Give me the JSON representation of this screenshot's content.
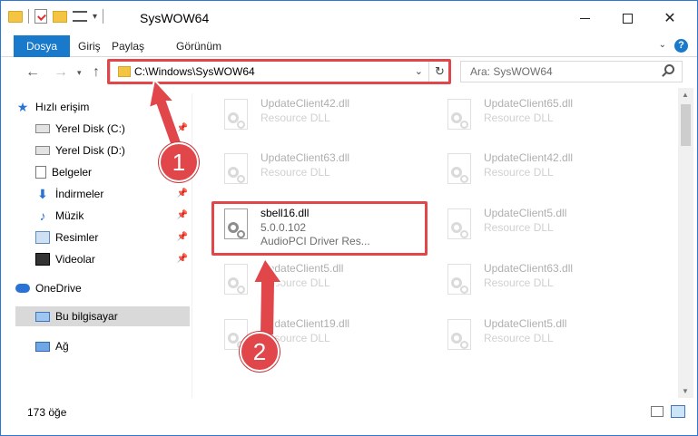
{
  "window": {
    "title": "SysWOW64",
    "close_symbol": "✕"
  },
  "ribbon": {
    "tabs": [
      "Dosya",
      "Giriş",
      "Paylaş",
      "Görünüm"
    ],
    "help": "?"
  },
  "address": {
    "path": "C:\\Windows\\SysWOW64"
  },
  "search": {
    "placeholder": "Ara: SysWOW64"
  },
  "sidebar": {
    "items": [
      {
        "label": "Hızlı erişim",
        "icon": "star-icon"
      },
      {
        "label": "Yerel Disk (C:)",
        "icon": "disk-icon",
        "pinned": true
      },
      {
        "label": "Yerel Disk (D:)",
        "icon": "disk-icon"
      },
      {
        "label": "Belgeler",
        "icon": "documents-icon"
      },
      {
        "label": "İndirmeler",
        "icon": "downloads-icon",
        "pinned": true
      },
      {
        "label": "Müzik",
        "icon": "music-icon",
        "pinned": true
      },
      {
        "label": "Resimler",
        "icon": "pictures-icon",
        "pinned": true
      },
      {
        "label": "Videolar",
        "icon": "videos-icon",
        "pinned": true
      },
      {
        "label": "OneDrive",
        "icon": "onedrive-icon"
      },
      {
        "label": "Bu bilgisayar",
        "icon": "this-pc-icon",
        "selected": true
      },
      {
        "label": "Ağ",
        "icon": "network-icon"
      }
    ]
  },
  "files": {
    "left": [
      {
        "name": "UpdateClient42.dll",
        "line1": "Resource DLL",
        "line2": ""
      },
      {
        "name": "UpdateClient63.dll",
        "line1": "Resource DLL",
        "line2": ""
      },
      {
        "name": "sbell16.dll",
        "line1": "5.0.0.102",
        "line2": "AudioPCI Driver Res..."
      },
      {
        "name": "UpdateClient5.dll",
        "line1": "Resource DLL",
        "line2": ""
      },
      {
        "name": "UpdateClient19.dll",
        "line1": "Resource DLL",
        "line2": ""
      }
    ],
    "right": [
      {
        "name": "UpdateClient65.dll",
        "line1": "Resource DLL",
        "line2": ""
      },
      {
        "name": "UpdateClient42.dll",
        "line1": "Resource DLL",
        "line2": ""
      },
      {
        "name": "UpdateClient5.dll",
        "line1": "Resource DLL",
        "line2": ""
      },
      {
        "name": "UpdateClient63.dll",
        "line1": "Resource DLL",
        "line2": ""
      },
      {
        "name": "UpdateClient5.dll",
        "line1": "Resource DLL",
        "line2": ""
      }
    ]
  },
  "status": {
    "count": "173 öğe"
  },
  "callouts": {
    "one": "1",
    "two": "2"
  },
  "colors": {
    "accent": "#1979ca",
    "highlight": "#e0464a",
    "selected_bg": "#d9d9d9"
  }
}
